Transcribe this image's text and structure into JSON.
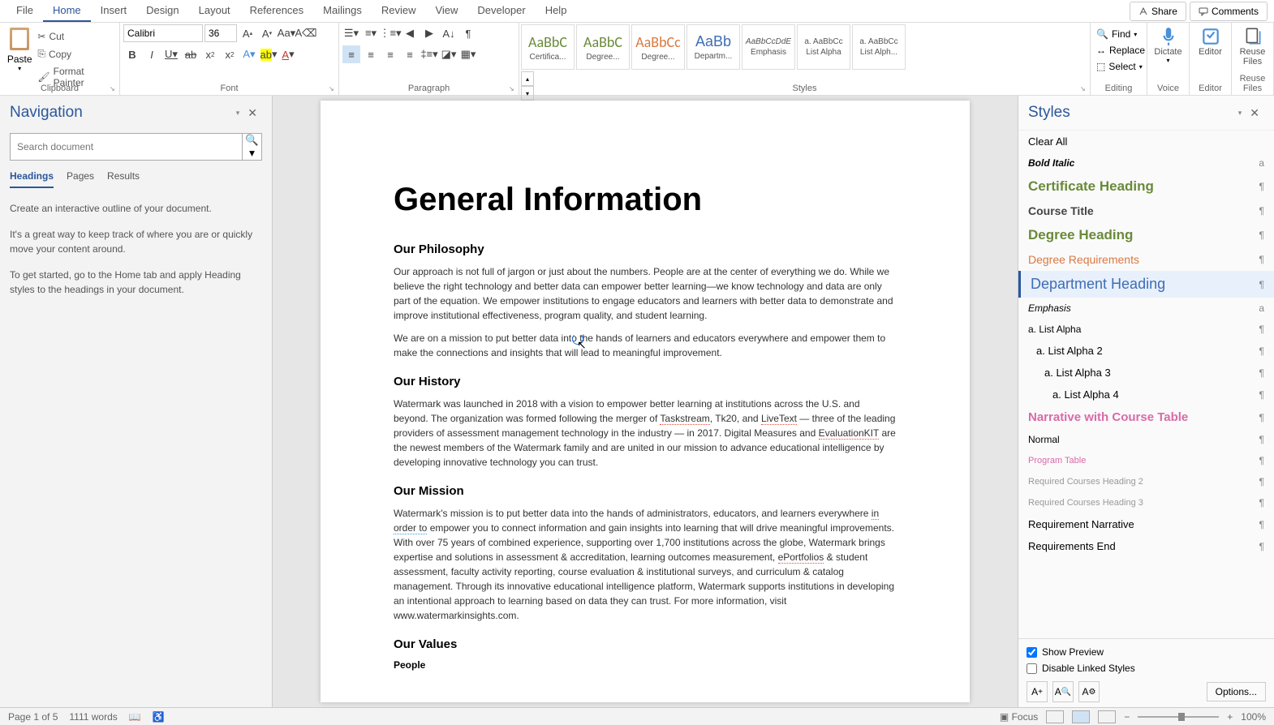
{
  "menu": {
    "items": [
      "File",
      "Home",
      "Insert",
      "Design",
      "Layout",
      "References",
      "Mailings",
      "Review",
      "View",
      "Developer",
      "Help"
    ],
    "active": "Home",
    "share": "Share",
    "comments": "Comments"
  },
  "ribbon": {
    "clipboard": {
      "paste": "Paste",
      "cut": "Cut",
      "copy": "Copy",
      "format_painter": "Format Painter",
      "label": "Clipboard"
    },
    "font": {
      "name": "Calibri",
      "size": "36",
      "label": "Font"
    },
    "paragraph": {
      "label": "Paragraph"
    },
    "styles": {
      "label": "Styles",
      "swatches": [
        {
          "preview": "AaBbC",
          "label": "Certifica...",
          "color": "#6a8a3a",
          "font": "Calibri"
        },
        {
          "preview": "AaBbC",
          "label": "Degree...",
          "color": "#6a8a3a",
          "font": "Calibri"
        },
        {
          "preview": "AaBbCc",
          "label": "Degree...",
          "color": "#d97942",
          "font": "Calibri"
        },
        {
          "preview": "AaBb",
          "label": "Departm...",
          "color": "#3d6db5",
          "font": "Arial"
        },
        {
          "preview": "AaBbCcDdE",
          "label": "Emphasis",
          "color": "#555",
          "style": "italic"
        },
        {
          "preview": "a. AaBbCc",
          "label": "List Alpha",
          "color": "#555"
        },
        {
          "preview": "a. AaBbCc",
          "label": "List Alph...",
          "color": "#555"
        }
      ]
    },
    "editing": {
      "find": "Find",
      "replace": "Replace",
      "select": "Select",
      "label": "Editing"
    },
    "voice": {
      "label": "Voice",
      "dictate": "Dictate"
    },
    "editor": {
      "label": "Editor",
      "btn": "Editor"
    },
    "reuse": {
      "label": "Reuse Files",
      "btn": "Reuse Files"
    }
  },
  "nav": {
    "title": "Navigation",
    "search_placeholder": "Search document",
    "tabs": [
      "Headings",
      "Pages",
      "Results"
    ],
    "active_tab": "Headings",
    "hint1": "Create an interactive outline of your document.",
    "hint2": "It's a great way to keep track of where you are or quickly move your content around.",
    "hint3": "To get started, go to the Home tab and apply Heading styles to the headings in your document."
  },
  "doc": {
    "title": "General Information",
    "h_philosophy": "Our Philosophy",
    "p_phil1": "Our approach is not full of jargon or just about the numbers. People are at the center of everything we do. While we believe the right technology and better data can empower better learning—we know technology and data are only part of the equation. We empower institutions to engage educators and learners with better data to demonstrate and improve institutional effectiveness, program quality, and student learning.",
    "p_phil2": "We are on a mission to put better data into the hands of learners and educators everywhere and empower them to make the connections and insights that will lead to meaningful improvement.",
    "h_history": "Our History",
    "p_hist": "Watermark was launched in 2018 with a vision to empower better learning at institutions across the U.S. and beyond. The organization was formed following the merger of Taskstream, Tk20, and LiveText — three of the leading providers of assessment management technology in the industry — in 2017. Digital Measures and EvaluationKIT are the newest members of the Watermark family and are united in our mission to advance educational intelligence by developing innovative technology you can trust.",
    "h_mission": "Our Mission",
    "p_mission": "Watermark's mission is to put better data into the hands of administrators, educators, and learners everywhere in order to empower you to connect information and gain insights into learning that will drive meaningful improvements. With over 75 years of combined experience, supporting over 1,700 institutions across the globe, Watermark brings expertise and solutions in assessment & accreditation, learning outcomes measurement, ePortfolios & student assessment, faculty activity reporting, course evaluation & institutional surveys, and curriculum & catalog management. Through its innovative educational intelligence platform, Watermark supports institutions in developing an intentional approach to learning based on data they can trust. For more information, visit www.watermarkinsights.com.",
    "h_values": "Our Values",
    "p_people": "People"
  },
  "styles_pane": {
    "title": "Styles",
    "clear_all": "Clear All",
    "items": [
      {
        "label": "Bold Italic",
        "marker": "a",
        "css": "font-weight:bold;font-style:italic;font-size:12px"
      },
      {
        "label": "Certificate Heading",
        "marker": "¶",
        "css": "color:#6a8a3a;font-size:17px;font-weight:600"
      },
      {
        "label": "Course Title",
        "marker": "¶",
        "css": "color:#444;font-size:14px;font-weight:600"
      },
      {
        "label": "Degree Heading",
        "marker": "¶",
        "css": "color:#6a8a3a;font-size:17px;font-weight:600"
      },
      {
        "label": "Degree Requirements",
        "marker": "¶",
        "css": "color:#d97942;font-size:14px"
      },
      {
        "label": "Department Heading",
        "marker": "¶",
        "css": "color:#3d6db5;font-size:18px;font-family:Arial",
        "selected": true
      },
      {
        "label": "Emphasis",
        "marker": "a",
        "css": "font-style:italic;font-size:12px"
      },
      {
        "label": "a.   List Alpha",
        "marker": "¶",
        "css": "font-size:12px"
      },
      {
        "label": "a.   List Alpha 2",
        "marker": "¶",
        "css": "font-size:13px;padding-left:10px"
      },
      {
        "label": "a.   List Alpha 3",
        "marker": "¶",
        "css": "font-size:13px;padding-left:20px"
      },
      {
        "label": "a.   List Alpha 4",
        "marker": "¶",
        "css": "font-size:13px;padding-left:30px"
      },
      {
        "label": "Narrative with Course Table",
        "marker": "¶",
        "css": "color:#d96aa8;font-size:15px;font-weight:600"
      },
      {
        "label": "Normal",
        "marker": "¶",
        "css": "font-size:12px"
      },
      {
        "label": "Program Table",
        "marker": "¶",
        "css": "color:#d96aa8;font-size:11px"
      },
      {
        "label": "Required Courses Heading 2",
        "marker": "¶",
        "css": "color:#999;font-size:11px"
      },
      {
        "label": "Required Courses Heading 3",
        "marker": "¶",
        "css": "color:#999;font-size:11px"
      },
      {
        "label": "Requirement Narrative",
        "marker": "¶",
        "css": "font-size:13px"
      },
      {
        "label": "Requirements End",
        "marker": "¶",
        "css": "font-size:13px"
      }
    ],
    "show_preview": "Show Preview",
    "disable_linked": "Disable Linked Styles",
    "options": "Options..."
  },
  "status": {
    "page": "Page 1 of 5",
    "words": "1111 words",
    "focus": "Focus",
    "zoom": "100%"
  }
}
